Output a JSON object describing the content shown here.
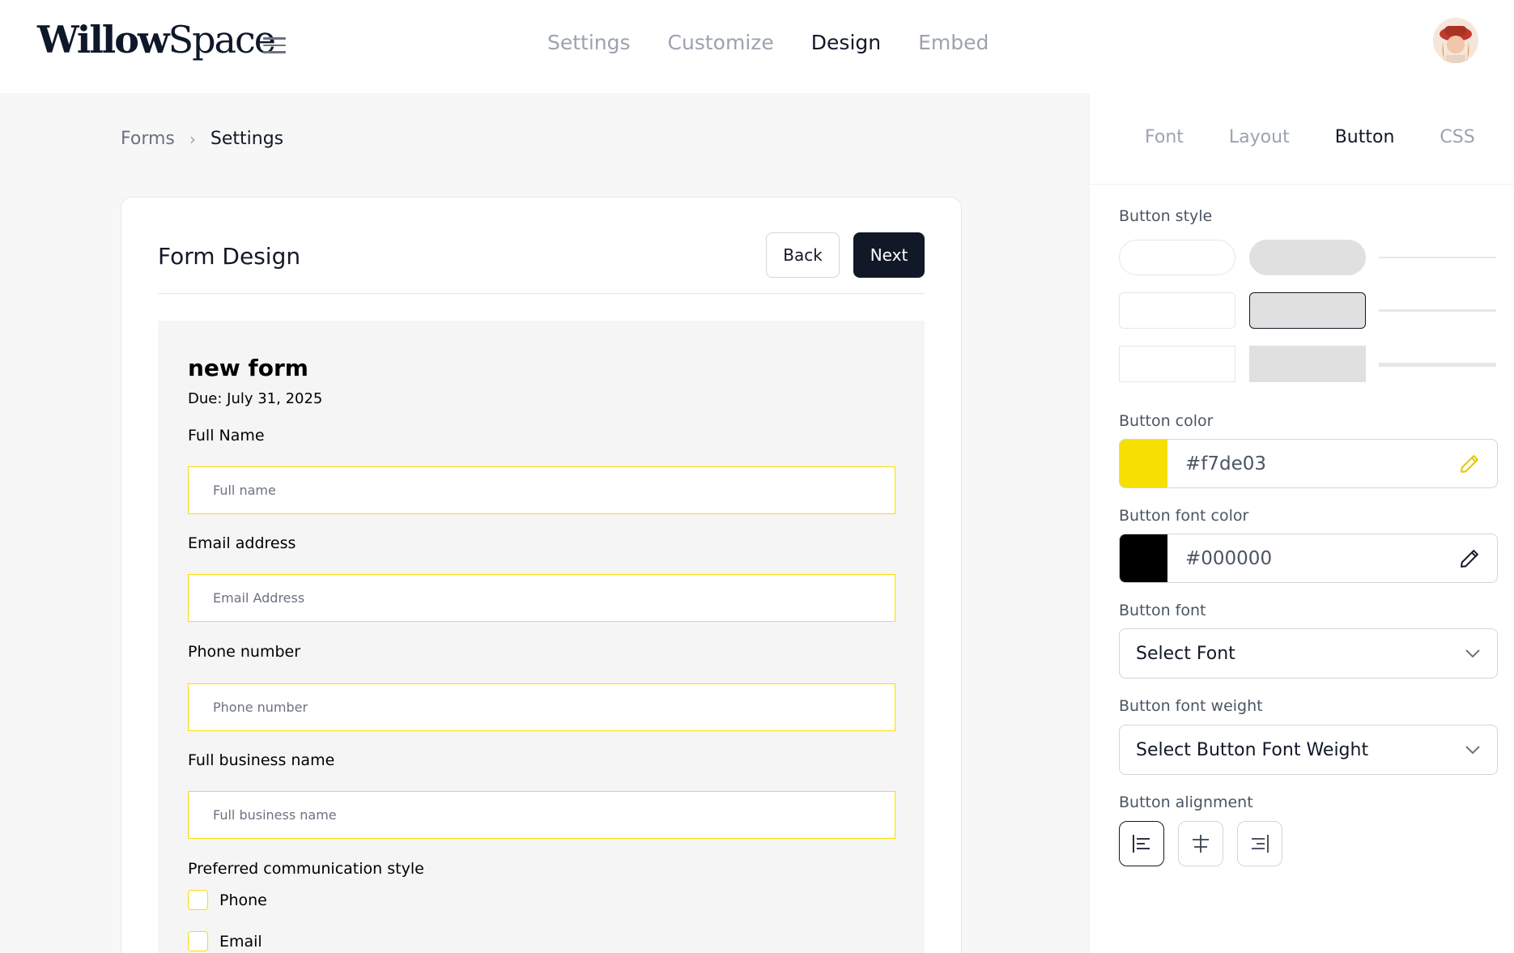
{
  "header": {
    "logo_bold": "Willow",
    "logo_light": "Space",
    "nav": [
      {
        "label": "Settings"
      },
      {
        "label": "Customize"
      },
      {
        "label": "Design"
      },
      {
        "label": "Embed"
      }
    ],
    "active_nav": "Design"
  },
  "breadcrumb": {
    "parent": "Forms",
    "separator": "›",
    "current": "Settings"
  },
  "card": {
    "title": "Form Design",
    "back_label": "Back",
    "next_label": "Next"
  },
  "form": {
    "name": "new form",
    "due": "Due: July 31, 2025",
    "fields": [
      {
        "label": "Full Name",
        "placeholder": "Full name"
      },
      {
        "label": "Email address",
        "placeholder": "Email Address"
      },
      {
        "label": "Phone number",
        "placeholder": "Phone number"
      },
      {
        "label": "Full business name",
        "placeholder": "Full business name"
      }
    ],
    "communication_label": "Preferred communication style",
    "options": [
      {
        "label": "Phone"
      },
      {
        "label": "Email"
      }
    ]
  },
  "panel": {
    "tabs": [
      {
        "label": "Font"
      },
      {
        "label": "Layout"
      },
      {
        "label": "Button"
      },
      {
        "label": "CSS"
      }
    ],
    "active_tab": "Button",
    "button_style_label": "Button style",
    "button_color_label": "Button color",
    "button_color": "#f7de03",
    "button_font_color_label": "Button font color",
    "button_font_color": "#000000",
    "button_font_label": "Button font",
    "button_font_value": "Select Font",
    "button_font_weight_label": "Button font weight",
    "button_font_weight_value": "Select Button Font Weight",
    "button_alignment_label": "Button alignment",
    "alignment_selected": "left"
  },
  "colors": {
    "accent_yellow": "#f7de03",
    "dark": "#111827"
  }
}
